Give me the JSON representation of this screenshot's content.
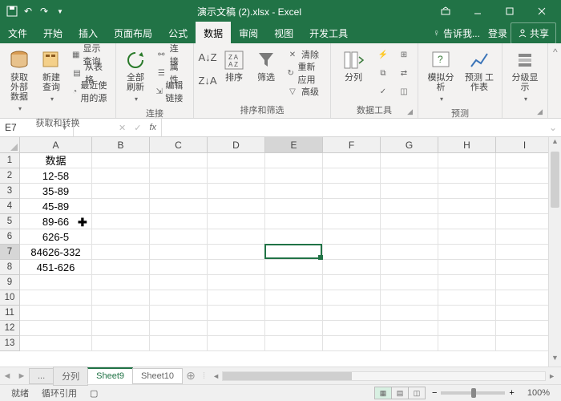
{
  "titlebar": {
    "title": "演示文稿 (2).xlsx - Excel"
  },
  "menutabs": {
    "items": [
      "文件",
      "开始",
      "插入",
      "页面布局",
      "公式",
      "数据",
      "审阅",
      "视图",
      "开发工具"
    ],
    "active": 5,
    "tell_me": "告诉我...",
    "signin": "登录",
    "share": "共享"
  },
  "ribbon": {
    "groups": [
      {
        "label": "获取和转换",
        "big": [
          {
            "txt": "获取\n外部数据",
            "id": "get-external-data"
          },
          {
            "txt": "新建\n查询",
            "id": "new-query"
          }
        ],
        "small": [
          {
            "txt": "显示查询",
            "id": "show-queries"
          },
          {
            "txt": "从表格",
            "id": "from-table"
          },
          {
            "txt": "最近使用的源",
            "id": "recent-sources"
          }
        ]
      },
      {
        "label": "连接",
        "big": [
          {
            "txt": "全部刷新",
            "id": "refresh-all"
          }
        ],
        "small": [
          {
            "txt": "连接",
            "id": "connections"
          },
          {
            "txt": "属性",
            "id": "properties"
          },
          {
            "txt": "编辑链接",
            "id": "edit-links"
          }
        ]
      },
      {
        "label": "排序和筛选",
        "items": [
          {
            "txt": "排序",
            "id": "sort"
          },
          {
            "txt": "筛选",
            "id": "filter"
          }
        ],
        "small": [
          {
            "txt": "清除",
            "id": "clear"
          },
          {
            "txt": "重新应用",
            "id": "reapply"
          },
          {
            "txt": "高级",
            "id": "advanced"
          }
        ]
      },
      {
        "label": "数据工具",
        "big": [
          {
            "txt": "分列",
            "id": "text-to-columns"
          }
        ]
      },
      {
        "label": "预测",
        "big": [
          {
            "txt": "模拟分析",
            "id": "what-if"
          },
          {
            "txt": "预测\n工作表",
            "id": "forecast-sheet"
          }
        ]
      },
      {
        "label": "分级显示",
        "big": [
          {
            "txt": "分级显示",
            "id": "outline"
          }
        ]
      }
    ]
  },
  "formula_bar": {
    "namebox": "E7",
    "fx": "fx",
    "value": ""
  },
  "grid": {
    "columns": [
      "A",
      "B",
      "C",
      "D",
      "E",
      "F",
      "G",
      "H",
      "I"
    ],
    "rows": 13,
    "data": {
      "1": {
        "A": "数据"
      },
      "2": {
        "A": "12-58"
      },
      "3": {
        "A": "35-89"
      },
      "4": {
        "A": "45-89"
      },
      "5": {
        "A": "89-66"
      },
      "6": {
        "A": "626-5"
      },
      "7": {
        "A": "84626-332"
      },
      "8": {
        "A": "451-626"
      }
    },
    "selection": {
      "col": "E",
      "row": 7
    },
    "cursor_at": {
      "col": "A",
      "row": 5
    }
  },
  "sheets": {
    "tabs": [
      "...",
      "分列",
      "Sheet9",
      "Sheet10"
    ],
    "active": 2
  },
  "status": {
    "ready": "就绪",
    "scroll_ref": "循环引用",
    "calc_icon": true,
    "zoom": "100%",
    "zoom_plus": "+",
    "zoom_minus": "−"
  }
}
